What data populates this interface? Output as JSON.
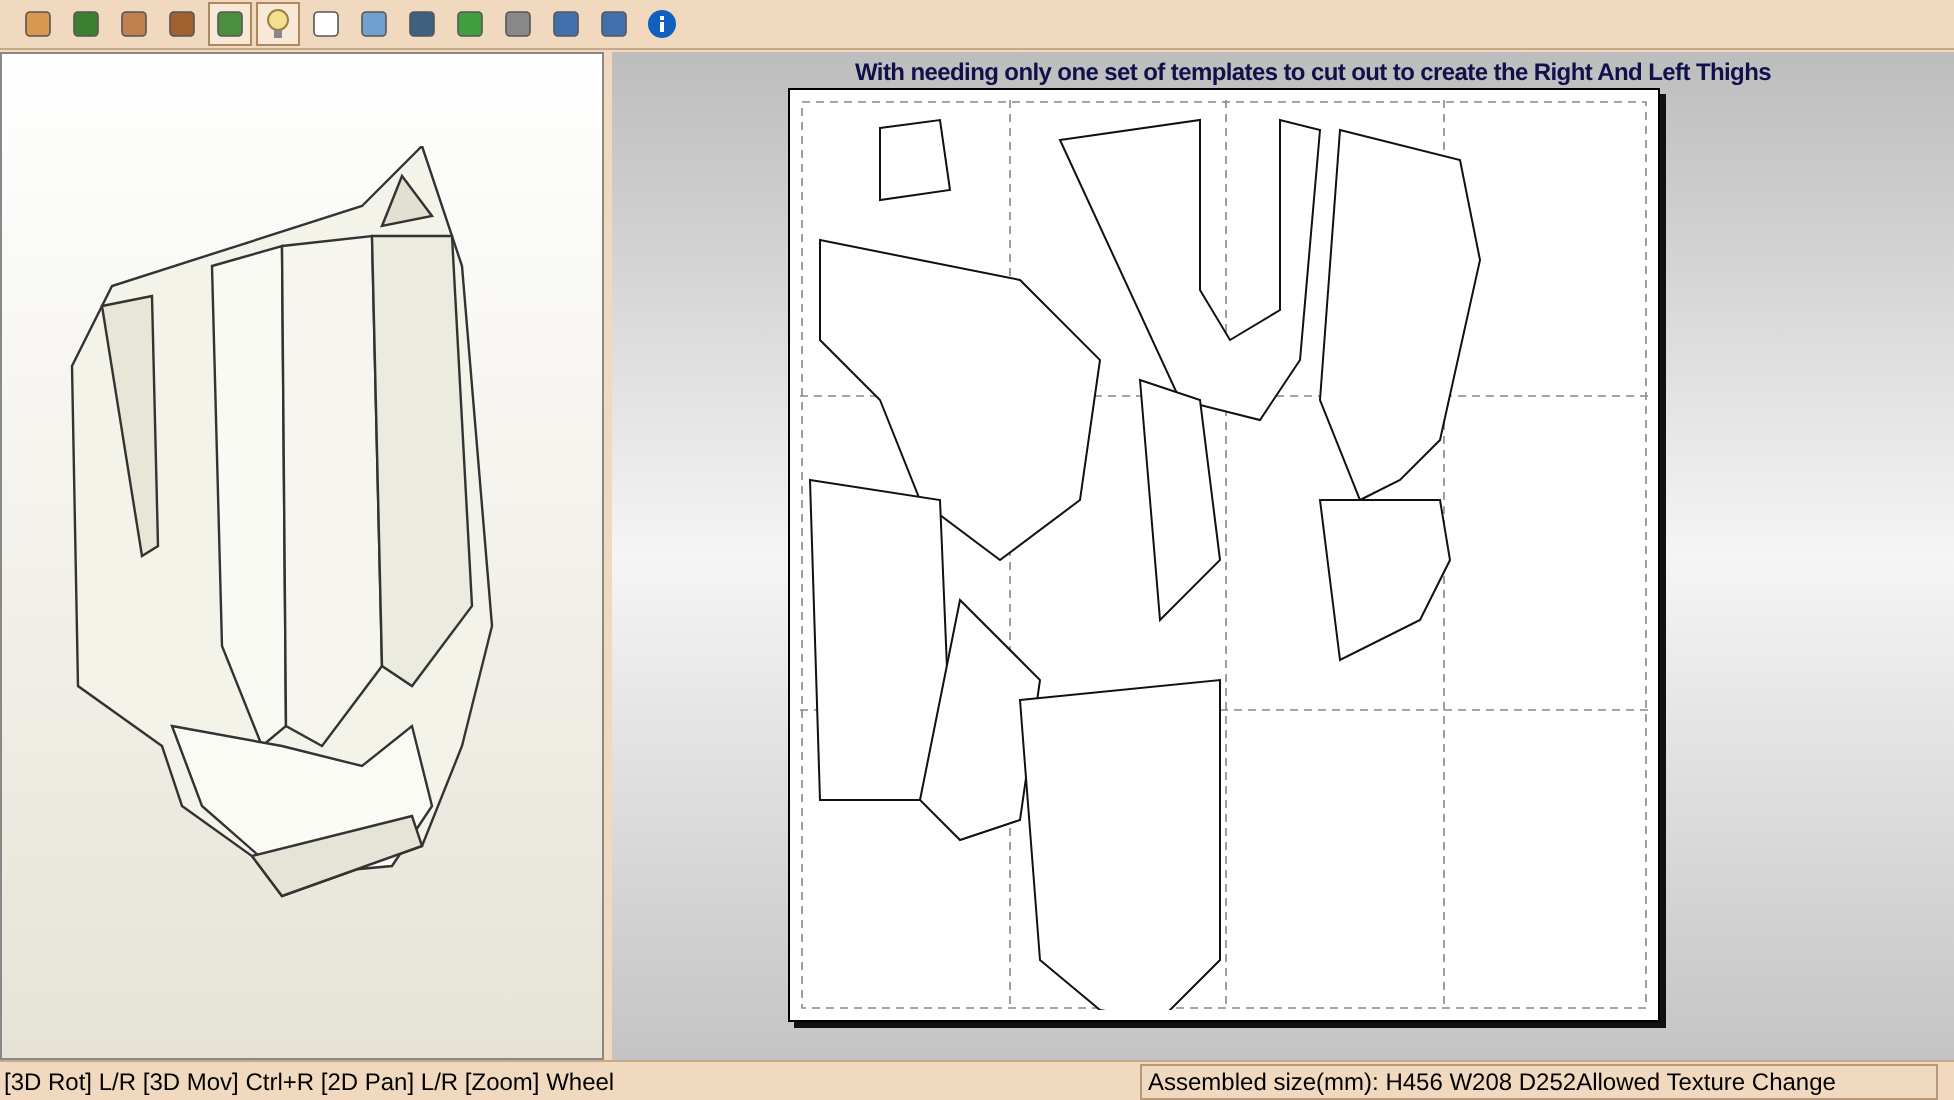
{
  "toolbar": {
    "buttons": [
      {
        "selected": false
      },
      {
        "selected": false
      },
      {
        "selected": false
      },
      {
        "selected": false
      },
      {
        "selected": true
      },
      {
        "selected": true
      },
      {
        "selected": false
      },
      {
        "selected": false
      },
      {
        "selected": false
      },
      {
        "selected": false
      },
      {
        "selected": false
      },
      {
        "selected": false
      },
      {
        "selected": false
      },
      {
        "selected": false
      }
    ]
  },
  "viewer_2d": {
    "caption": "With needing only one set of templates to cut out to create the Right And Left Thighs"
  },
  "status_bar": {
    "hint": "[3D Rot] L/R [3D Mov] Ctrl+R [2D Pan] L/R [Zoom] Wheel",
    "info": "Assembled size(mm): H456 W208 D252Allowed Texture Change"
  }
}
